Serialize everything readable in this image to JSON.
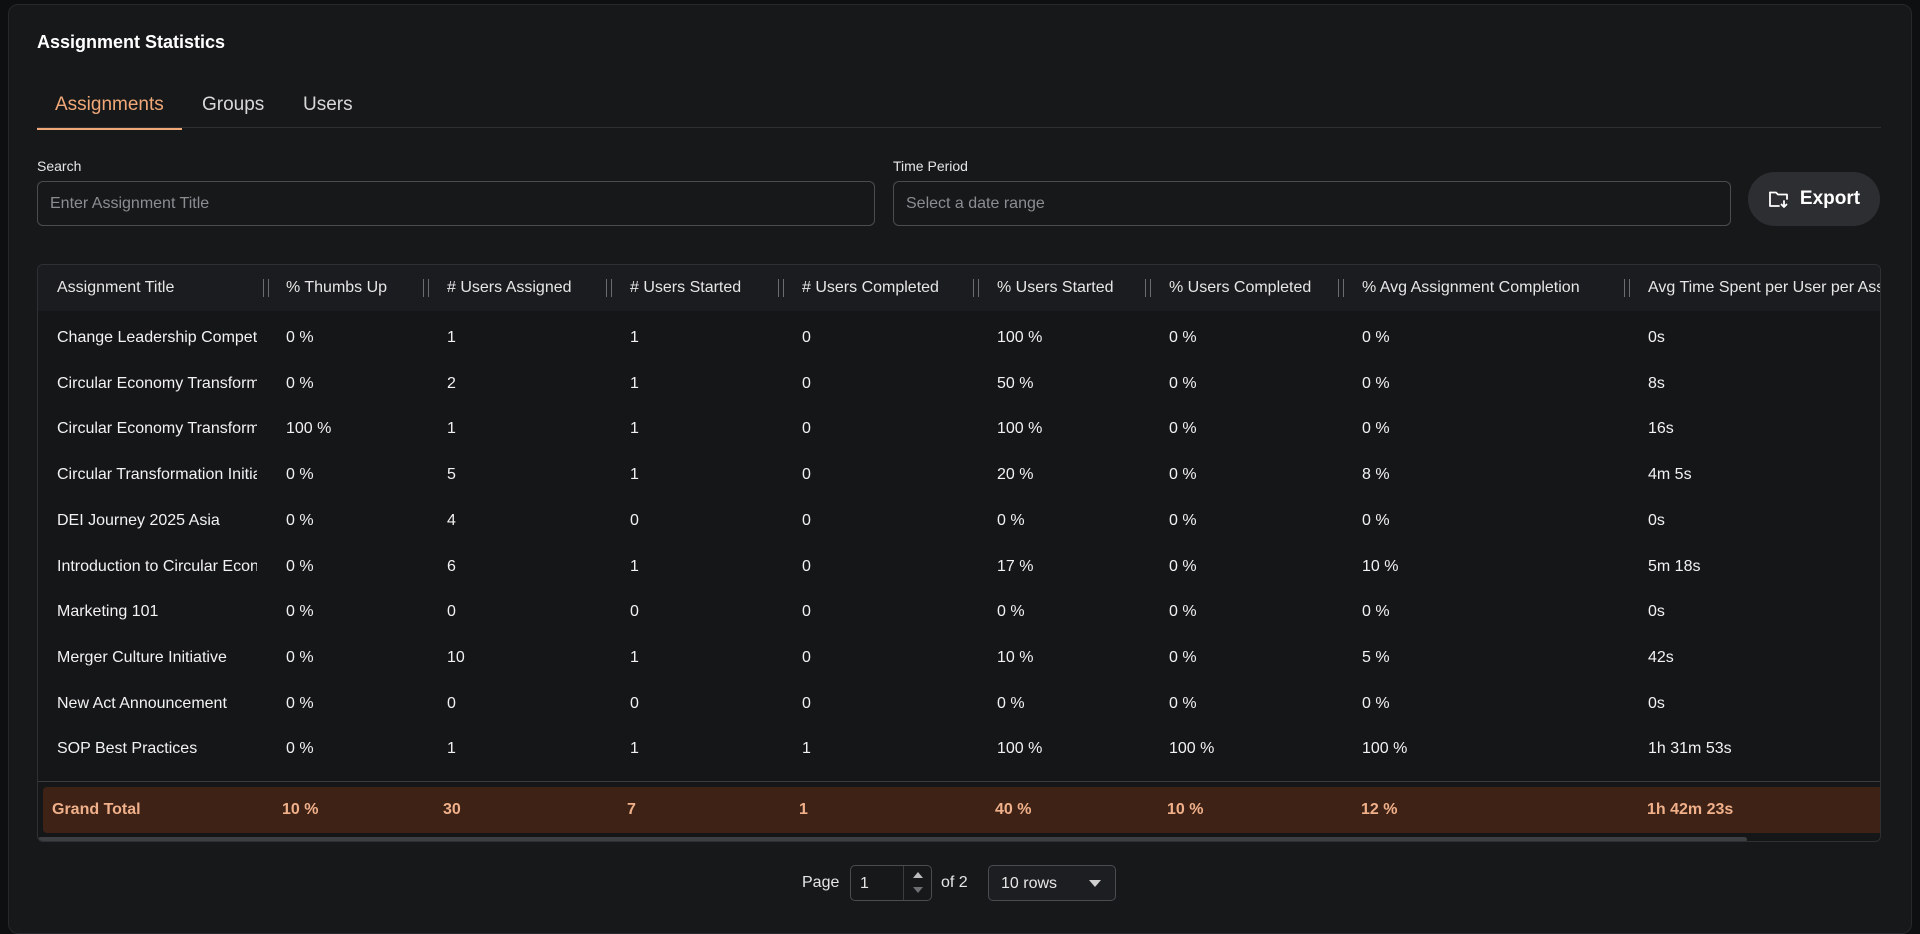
{
  "header": {
    "title": "Assignment Statistics"
  },
  "tabs": [
    {
      "label": "Assignments",
      "active": true
    },
    {
      "label": "Groups",
      "active": false
    },
    {
      "label": "Users",
      "active": false
    }
  ],
  "filters": {
    "search_label": "Search",
    "search_placeholder": "Enter Assignment Title",
    "time_label": "Time Period",
    "time_placeholder": "Select a date range",
    "export_label": "Export"
  },
  "table": {
    "columns": [
      "Assignment Title",
      "% Thumbs Up",
      "# Users Assigned",
      "# Users Started",
      "# Users Completed",
      "% Users Started",
      "% Users Completed",
      "% Avg Assignment Completion",
      "Avg Time Spent per User per Assignment"
    ],
    "rows": [
      [
        "Change Leadership Competencies",
        "0 %",
        "1",
        "1",
        "0",
        "100 %",
        "0 %",
        "0 %",
        "0s"
      ],
      [
        "Circular Economy Transformation",
        "0 %",
        "2",
        "1",
        "0",
        "50 %",
        "0 %",
        "0 %",
        "8s"
      ],
      [
        "Circular Economy Transformation",
        "100 %",
        "1",
        "1",
        "0",
        "100 %",
        "0 %",
        "0 %",
        "16s"
      ],
      [
        "Circular Transformation Initiative",
        "0 %",
        "5",
        "1",
        "0",
        "20 %",
        "0 %",
        "8 %",
        "4m 5s"
      ],
      [
        "DEI Journey 2025 Asia",
        "0 %",
        "4",
        "0",
        "0",
        "0 %",
        "0 %",
        "0 %",
        "0s"
      ],
      [
        "Introduction to Circular Economy",
        "0 %",
        "6",
        "1",
        "0",
        "17 %",
        "0 %",
        "10 %",
        "5m 18s"
      ],
      [
        "Marketing 101",
        "0 %",
        "0",
        "0",
        "0",
        "0 %",
        "0 %",
        "0 %",
        "0s"
      ],
      [
        "Merger Culture Initiative",
        "0 %",
        "10",
        "1",
        "0",
        "10 %",
        "0 %",
        "5 %",
        "42s"
      ],
      [
        "New Act Announcement",
        "0 %",
        "0",
        "0",
        "0",
        "0 %",
        "0 %",
        "0 %",
        "0s"
      ],
      [
        "SOP Best Practices",
        "0 %",
        "1",
        "1",
        "1",
        "100 %",
        "100 %",
        "100 %",
        "1h 31m 53s"
      ]
    ],
    "total": [
      "Grand Total",
      "10 %",
      "30",
      "7",
      "1",
      "40 %",
      "10 %",
      "12 %",
      "1h 42m 23s"
    ]
  },
  "pagination": {
    "page_label": "Page",
    "current_page": "1",
    "of_label": "of 2",
    "rows_option": "10 rows"
  },
  "colors": {
    "accent": "#f0a878",
    "total_bg": "#3e2216",
    "total_text": "#f0b08a"
  }
}
